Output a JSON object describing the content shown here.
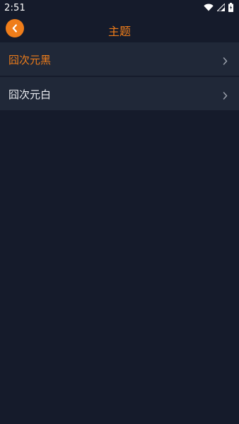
{
  "status_bar": {
    "time": "2:51",
    "icons": [
      "wifi-icon",
      "cell-signal-icon",
      "battery-icon"
    ]
  },
  "app_bar": {
    "title": "主题",
    "back_icon": "chevron-left-icon"
  },
  "theme_options": [
    {
      "label": "囧次元黑",
      "selected": true
    },
    {
      "label": "囧次元白",
      "selected": false
    }
  ],
  "colors": {
    "background": "#151b2b",
    "row_background": "#202838",
    "accent": "#ef7d1a",
    "text": "#eef0f4",
    "chevron": "#9aa0ab"
  }
}
